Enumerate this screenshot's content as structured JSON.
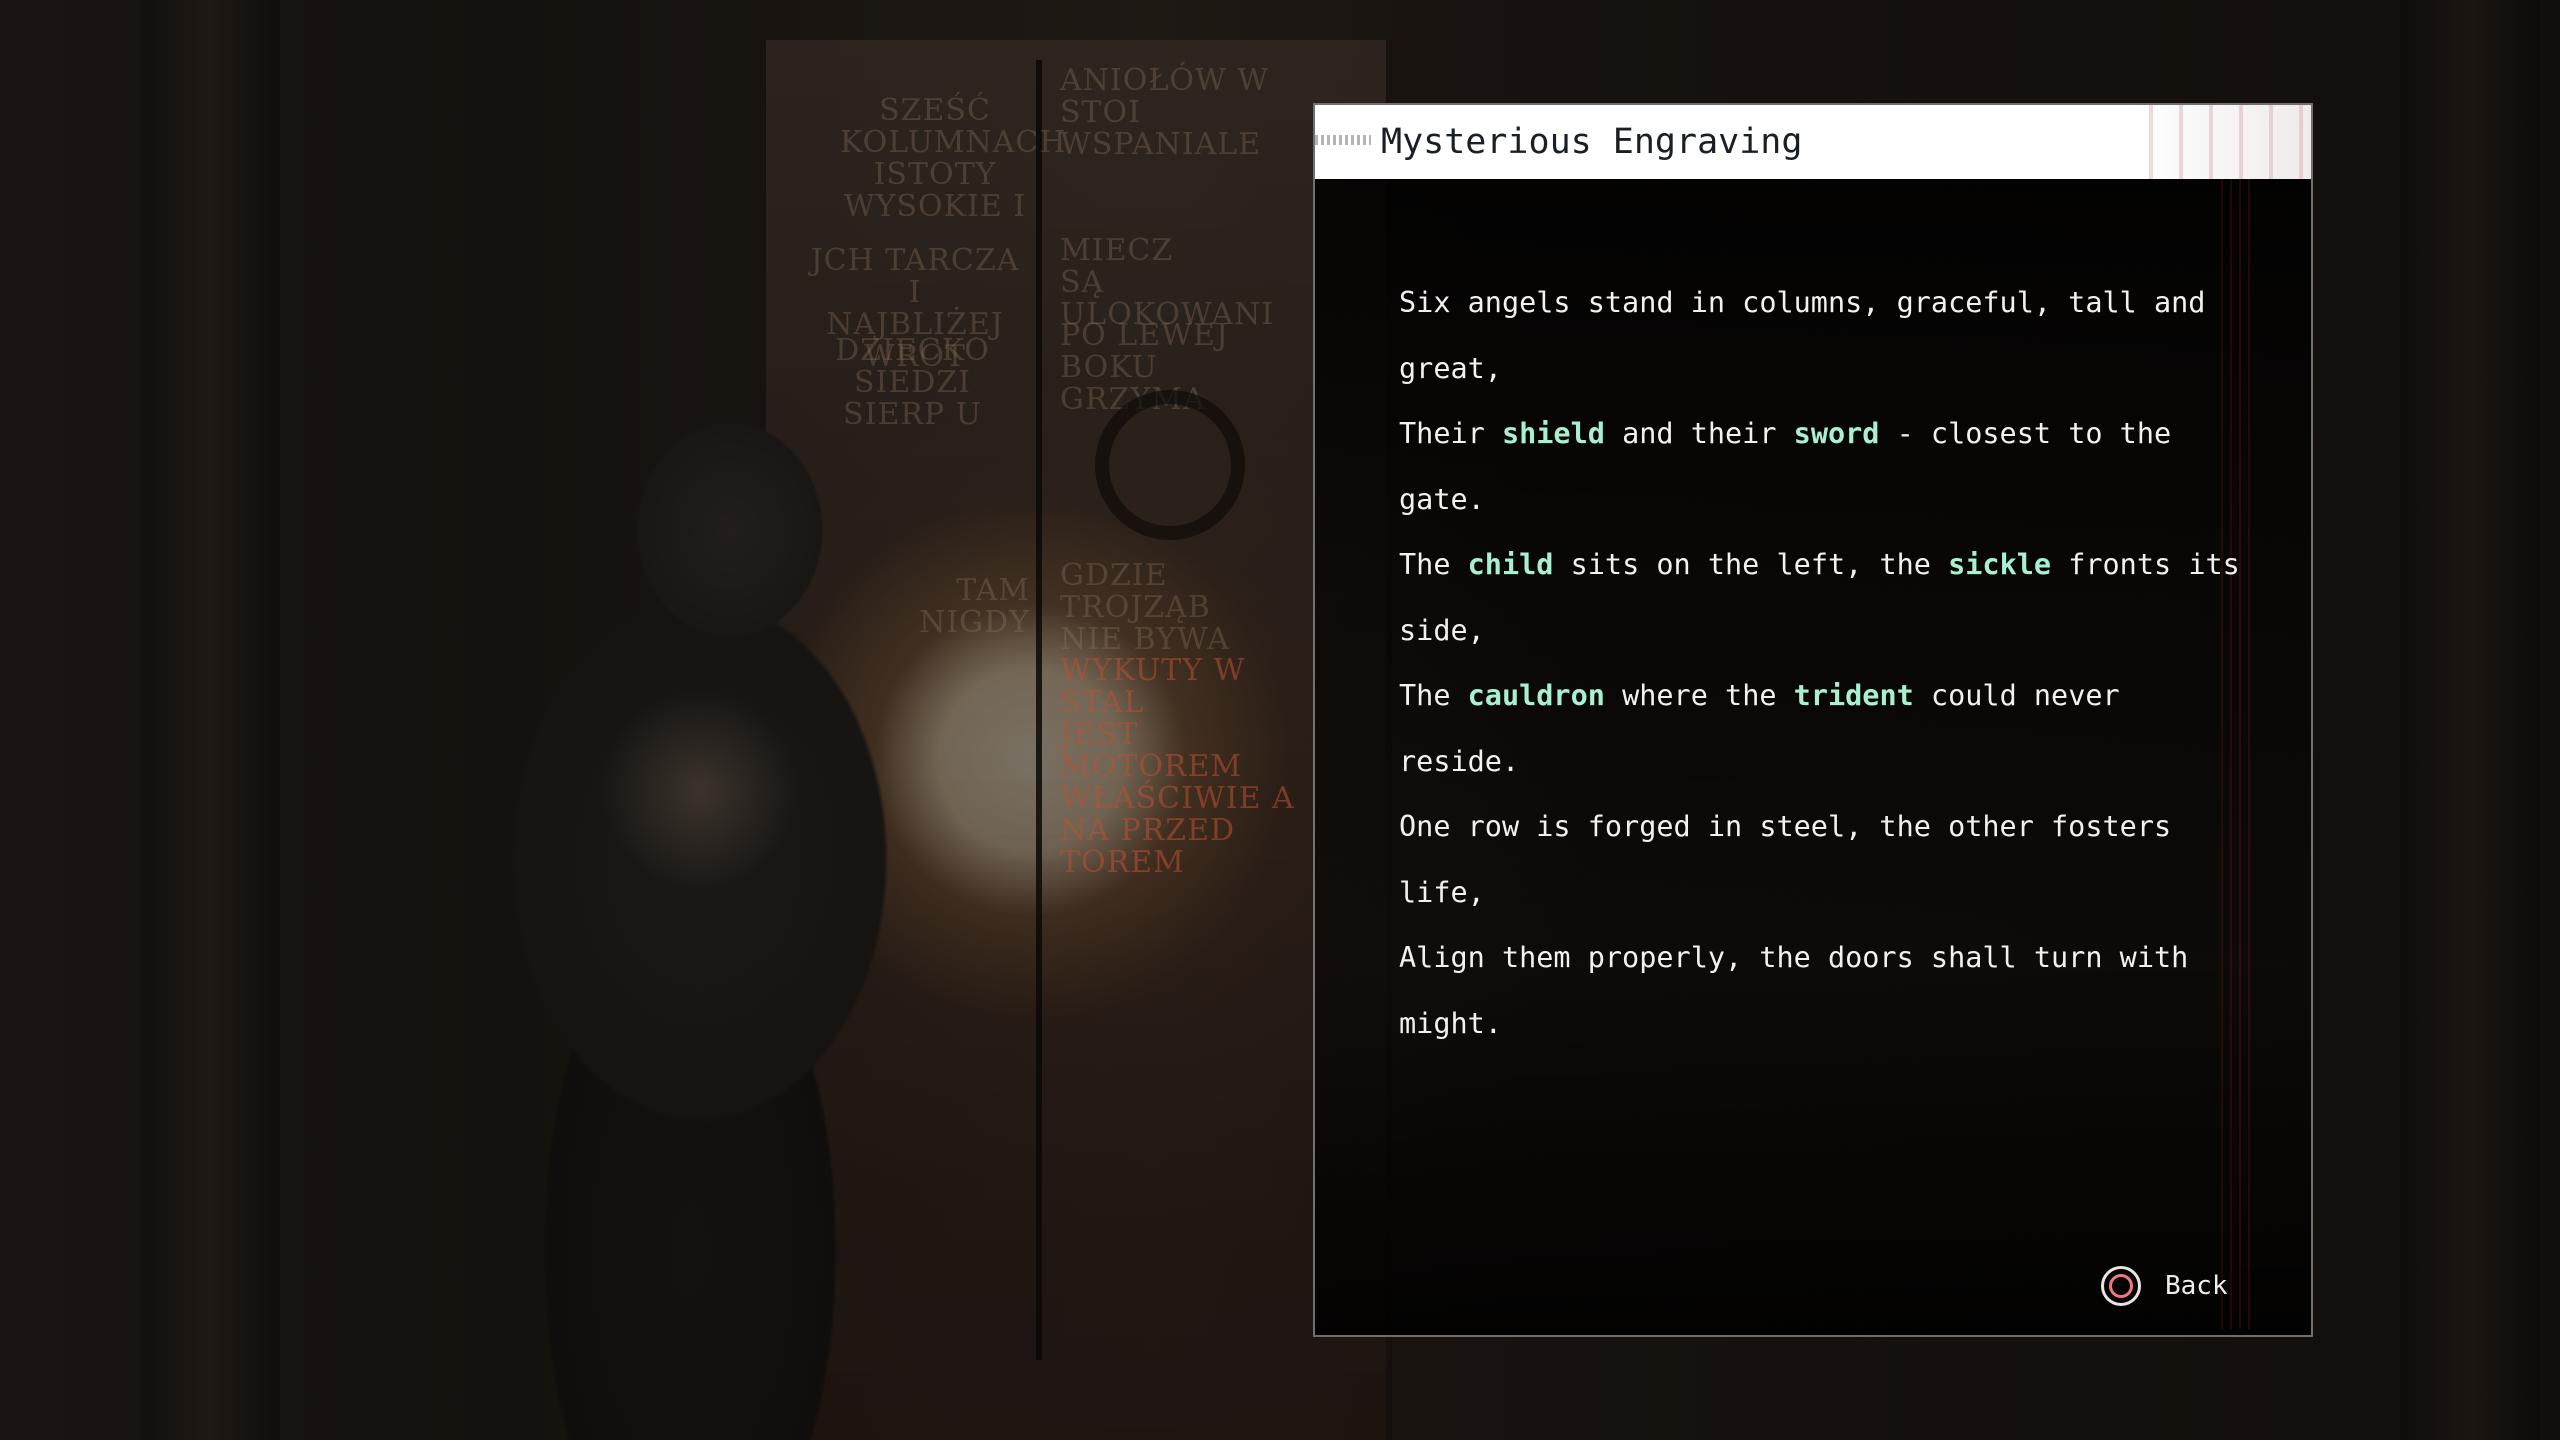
{
  "background": {
    "engravings_left": [
      "SZEŚĆ",
      "KOLUMNACH",
      "ISTOTY",
      "WYSOKIE I"
    ],
    "engravings_right": [
      "ANIOŁÓW W",
      "STOI",
      "WSPANIALE"
    ],
    "engravings_left_2": [
      "JCH TARCZA I",
      "NAJBLIŻEJ WROT"
    ],
    "engravings_right_2": [
      "MIECZ",
      "SĄ ULOKOWANI"
    ],
    "engravings_left_3": [
      "DZIECKO SIEDZI",
      "SIERP U"
    ],
    "engravings_right_3": [
      "PO LEWEJ",
      "BOKU GRZYMA"
    ],
    "engravings_left_4": [
      "TAM",
      "NIGDY"
    ],
    "engravings_right_4": [
      "GDZIE TROJZĄB",
      "NIE BYWA"
    ],
    "engravings_lit": [
      "WYKUTY W STAL",
      "JEST MOTOREM",
      "WŁAŚCIWIE A",
      "NA PRZED",
      "TOREM"
    ]
  },
  "dialog": {
    "title": "Mysterious Engraving",
    "colors": {
      "keyword": "#a9f0d0",
      "text": "#f3f1ee",
      "header_bg": "#ffffff"
    },
    "lines": [
      {
        "segments": [
          {
            "text": "Six angels stand in columns, graceful, tall and great,"
          }
        ]
      },
      {
        "segments": [
          {
            "text": "Their "
          },
          {
            "text": "shield",
            "kw": true
          },
          {
            "text": " and their "
          },
          {
            "text": "sword",
            "kw": true
          },
          {
            "text": " - closest to the gate."
          }
        ]
      },
      {
        "segments": [
          {
            "text": "The "
          },
          {
            "text": "child",
            "kw": true
          },
          {
            "text": " sits on the left, the "
          },
          {
            "text": "sickle",
            "kw": true
          },
          {
            "text": " fronts its side,"
          }
        ]
      },
      {
        "segments": [
          {
            "text": "The "
          },
          {
            "text": "cauldron",
            "kw": true
          },
          {
            "text": " where the "
          },
          {
            "text": "trident",
            "kw": true
          },
          {
            "text": " could never reside."
          }
        ]
      },
      {
        "segments": [
          {
            "text": "One row is forged in steel, the other fosters life,"
          }
        ]
      },
      {
        "segments": [
          {
            "text": "Align them properly, the doors shall turn with might."
          }
        ]
      }
    ],
    "back": {
      "icon": "circle-button-icon",
      "label": "Back"
    }
  }
}
